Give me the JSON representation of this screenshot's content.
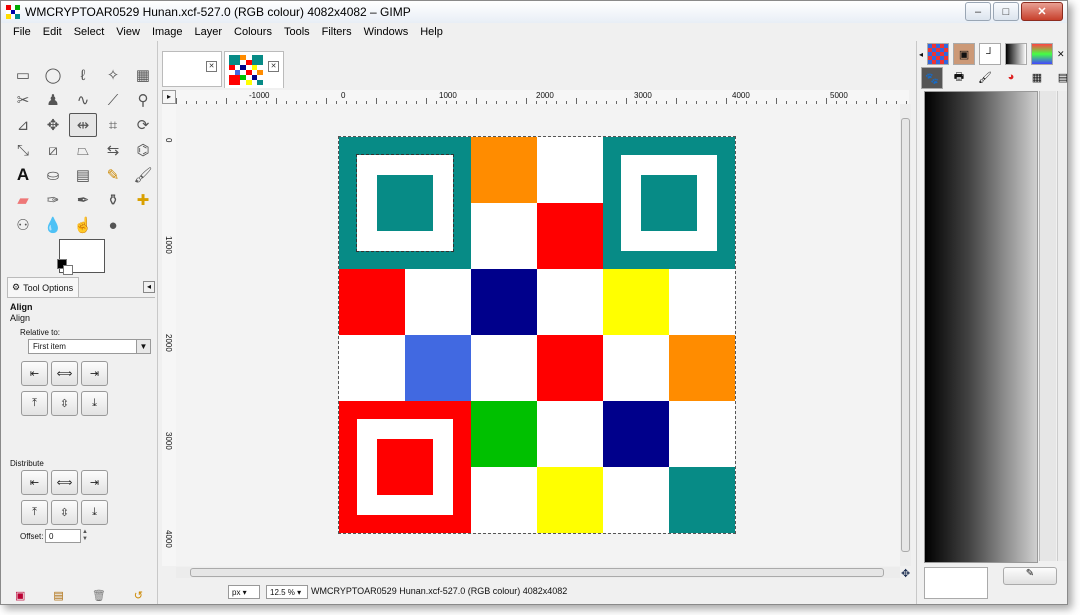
{
  "window": {
    "title": "WMCRYPTOAR0529 Hunan.xcf-527.0 (RGB colour) 4082x4082 – GIMP",
    "minimize_label": "–",
    "maximize_label": "□",
    "close_label": "✕"
  },
  "menu": [
    {
      "label": "File"
    },
    {
      "label": "Edit"
    },
    {
      "label": "Select"
    },
    {
      "label": "View"
    },
    {
      "label": "Image"
    },
    {
      "label": "Layer"
    },
    {
      "label": "Colours"
    },
    {
      "label": "Tools"
    },
    {
      "label": "Filters"
    },
    {
      "label": "Windows"
    },
    {
      "label": "Help"
    }
  ],
  "tool_options": {
    "tab_label": "Tool Options",
    "title": "Align",
    "subtitle": "Align",
    "relative_to_label": "Relative to:",
    "relative_to_value": "First item",
    "distribute_label": "Distribute",
    "offset_label": "Offset:",
    "offset_value": "0"
  },
  "ruler": {
    "h_labels": [
      "-1000",
      "0",
      "1000",
      "2000",
      "3000",
      "4000",
      "5000"
    ],
    "v_labels": [
      "0",
      "1000",
      "2000",
      "3000",
      "4000"
    ]
  },
  "status": {
    "unit": "px",
    "zoom": "12.5 %",
    "text": "WMCRYPTOAR0529 Hunan.xcf-527.0 (RGB colour) 4082x4082"
  },
  "image_grid": {
    "colors": {
      "teal": "#078b86",
      "orange": "#ff8c00",
      "red": "#ff0000",
      "white": "#ffffff",
      "navy": "#00008b",
      "yellow": "#ffff00",
      "blue": "#4169e1",
      "green": "#00c000"
    },
    "cells": [
      [
        "F",
        "F",
        "orange",
        "white",
        "F",
        "F"
      ],
      [
        "F",
        "F",
        "white",
        "red",
        "F",
        "F"
      ],
      [
        "red",
        "white",
        "navy",
        "white",
        "yellow",
        "white"
      ],
      [
        "white",
        "blue",
        "white",
        "red",
        "white",
        "orange"
      ],
      [
        "F",
        "F",
        "green",
        "white",
        "navy",
        "white"
      ],
      [
        "F",
        "F",
        "white",
        "yellow",
        "white",
        "teal"
      ]
    ],
    "finders": [
      {
        "position": "top-left",
        "color": "teal"
      },
      {
        "position": "top-right",
        "color": "teal"
      },
      {
        "position": "bottom-left",
        "color": "red"
      }
    ]
  }
}
